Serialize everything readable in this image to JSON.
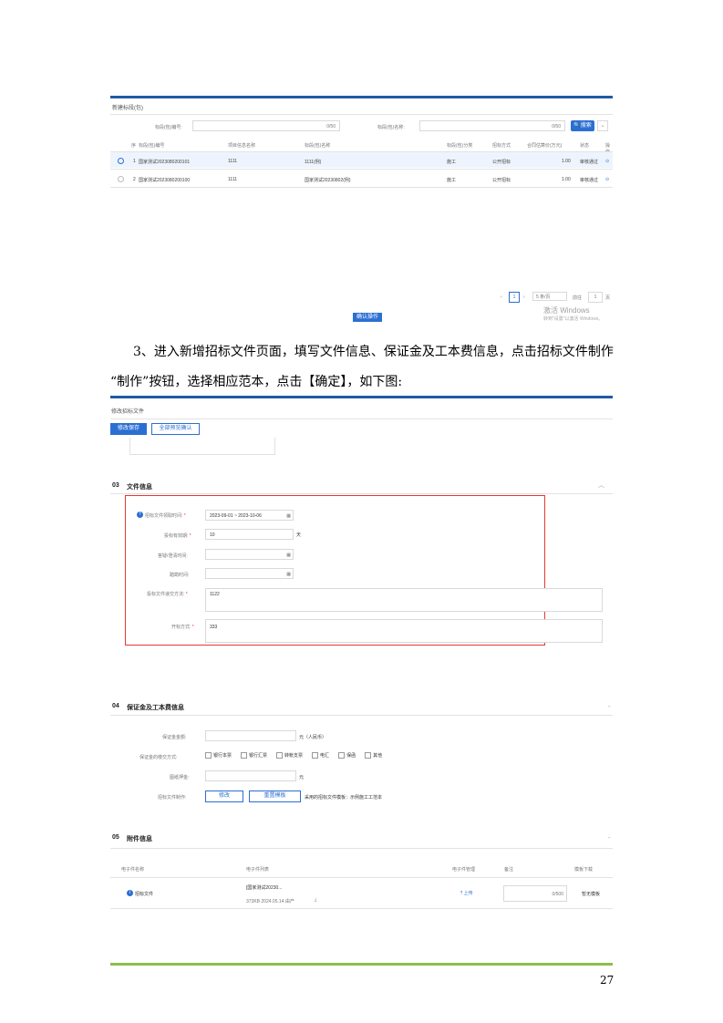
{
  "s1": {
    "panel_title": "新建标段(包)",
    "search1_label": "标段(包)编号:",
    "search1_count": "0/50",
    "search2_label": "标段(包)名称:",
    "search2_count": "0/50",
    "search_button": "搜索",
    "columns": [
      "序",
      "标段(包)编号",
      "项目信息名称",
      "标段(包)名称",
      "标段(包)分类",
      "招标方式",
      "合同估算价(万元)",
      "状态",
      "操作"
    ],
    "rows": [
      [
        "1",
        "国家测试2023080200101",
        "1111",
        "1111(例)",
        "施工",
        "公开招标",
        "1.00",
        "审核通过",
        "⊙"
      ],
      [
        "2",
        "国家测试2023080200100",
        "1111",
        "国家测试20230802(例)",
        "施工",
        "公开招标",
        "1.00",
        "审核通过",
        "⊙"
      ]
    ],
    "pager": {
      "page": "1",
      "size": "5 条/页",
      "goto_label": "前往",
      "goto_value": "1",
      "goto_suffix": "页"
    },
    "watermark_line1": "激活 Windows",
    "watermark_line2": "转到\"设置\"以激活 Windows。",
    "confirm_button": "确认操作"
  },
  "paragraph": {
    "line1": "3、进入新增招标文件页面，填写文件信息、保证金及工本费信息，点击招标文件制作",
    "line2": "“制作”按钮，选择相应范本，点击【确定】，如下图:"
  },
  "s2": {
    "panel_title": "修改招标文件",
    "btn_save": "修改保存",
    "btn_preview": "全部预览确认",
    "sec03_num": "03",
    "sec03_title": "文件信息",
    "fields": {
      "f1_label": "招标文件领取时间:",
      "f1_value": "2023-09-01 ~ 2023-10-06",
      "f2_label": "投标有效期:",
      "f2_value": "10",
      "f2_unit": "天",
      "f3_label": "答疑/澄清时间:",
      "f4_label": "踏勘时间:",
      "f5_label": "投标文件递交方法:",
      "f5_value": "1122",
      "f6_label": "开标方式:",
      "f6_value": "333"
    },
    "sec04_num": "04",
    "sec04_title": "保证金及工本费信息",
    "deposit": {
      "amount_label": "保证金金额:",
      "amount_unit": "元（人民币）",
      "method_label": "保证金的缴交方式:",
      "methods": [
        "银行本票",
        "银行汇票",
        "转帐支票",
        "电汇",
        "保函",
        "其他"
      ],
      "cost_label": "图纸押金:",
      "cost_unit": "元",
      "make_label": "招标文件制作:",
      "make_btn": "修改",
      "reset_btn": "重置模板",
      "template_text": "采用的招标文件模板：示例施工工范本"
    },
    "sec05_num": "05",
    "sec05_title": "附件信息",
    "attach_cols": [
      "电子件名称",
      "电子件列表",
      "电子件管理",
      "备注",
      "模板下载"
    ],
    "attach_row": {
      "name": "招标文件",
      "file": "[国家测试20230...",
      "meta": "373KB 2024.05.14 由产",
      "upload": "上传",
      "remark_count": "0/500",
      "download": "暂无模板"
    }
  },
  "page_number": "27"
}
